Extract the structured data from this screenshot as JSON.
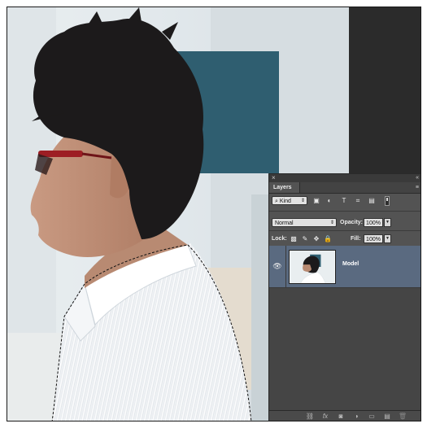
{
  "canvas": {
    "photo_subject": "person-in-profile-with-selection"
  },
  "layers_panel": {
    "close_glyph": "×",
    "collapse_glyph": "«",
    "tab_label": "Layers",
    "menu_glyph": "≡",
    "filter": {
      "kind_label": "Kind",
      "search_glyph": "⌕",
      "icons": [
        "image-filter-icon",
        "adjustment-filter-icon",
        "type-filter-icon",
        "shape-filter-icon",
        "smart-object-filter-icon"
      ],
      "icon_glyphs": [
        "▣",
        "◐",
        "T",
        "⌗",
        "▤"
      ]
    },
    "blend_mode": "Normal",
    "opacity_label": "Opacity:",
    "opacity_value": "100%",
    "lock_label": "Lock:",
    "lock_icons": [
      "lock-transparent-pixels-icon",
      "lock-image-pixels-icon",
      "lock-position-icon",
      "lock-all-icon"
    ],
    "lock_glyphs": [
      "▩",
      "✎",
      "✥",
      "🔒"
    ],
    "fill_label": "Fill:",
    "fill_value": "100%",
    "layers": [
      {
        "name": "Model",
        "visible": true,
        "selected": true
      }
    ],
    "eye_glyph": "👁",
    "footer_icons": [
      "link-layers-icon",
      "fx-icon",
      "add-mask-icon",
      "new-adjustment-layer-icon",
      "new-group-icon",
      "new-layer-icon",
      "delete-layer-icon"
    ],
    "footer_glyphs": [
      "⛓",
      "fx",
      "◙",
      "◑",
      "▭",
      "▤",
      "🗑"
    ]
  },
  "colors": {
    "panel_bg": "#535353",
    "selected_layer": "#5a6a80",
    "canvas_dark": "#2b2b2b"
  }
}
